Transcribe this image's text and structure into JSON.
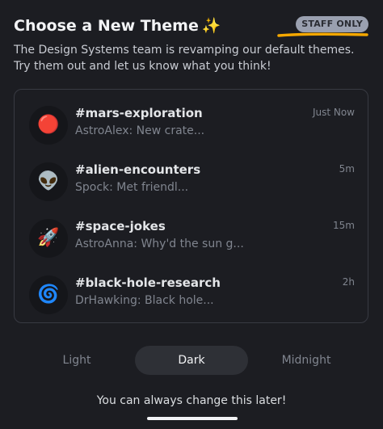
{
  "header": {
    "title": "Choose a New Theme",
    "title_emoji": "✨",
    "badge": "STAFF ONLY"
  },
  "description": "The Design Systems team is revamping our default themes. Try them out and let us know what you think!",
  "channels": [
    {
      "icon": "🔴",
      "icon_name": "red-circle-icon",
      "name": "#mars-exploration",
      "preview": "AstroAlex: New crate...",
      "time": "Just Now"
    },
    {
      "icon": "👽",
      "icon_name": "alien-icon",
      "name": "#alien-encounters",
      "preview": "Spock: Met friendl...",
      "time": "5m"
    },
    {
      "icon": "🚀",
      "icon_name": "rocket-icon",
      "name": "#space-jokes",
      "preview": "AstroAnna: Why'd the sun g...",
      "time": "15m"
    },
    {
      "icon": "🌀",
      "icon_name": "cyclone-icon",
      "name": "#black-hole-research",
      "preview": "DrHawking: Black hole...",
      "time": "2h"
    }
  ],
  "themes": {
    "options": [
      "Light",
      "Dark",
      "Midnight"
    ],
    "selected": "Dark"
  },
  "footnote": "You can always change this later!",
  "colors": {
    "background": "#1c1d22",
    "badge": "#9aa0b0",
    "highlight_underline": "#f5a800"
  }
}
